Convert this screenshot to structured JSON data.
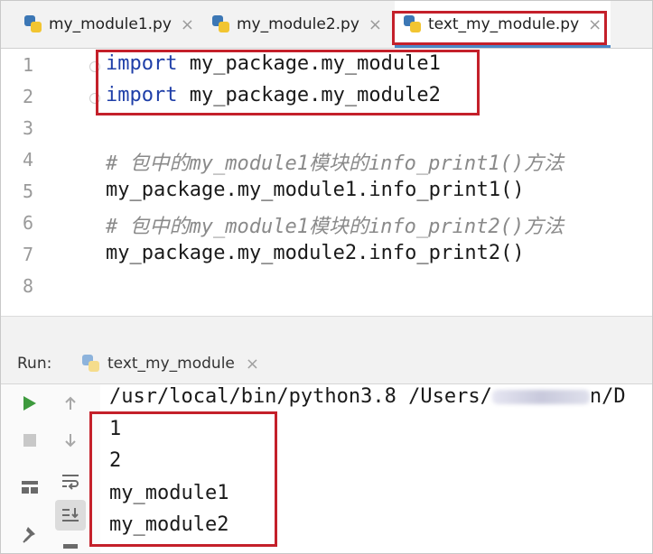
{
  "tabs": [
    {
      "label": "my_module1.py",
      "close": "×"
    },
    {
      "label": "my_module2.py",
      "close": "×"
    },
    {
      "label": "text_my_module.py",
      "close": "×"
    }
  ],
  "editor": {
    "line_numbers": [
      "1",
      "2",
      "3",
      "4",
      "5",
      "6",
      "7",
      "8"
    ],
    "lines": {
      "l1_kw": "import",
      "l1_rest": " my_package.my_module1",
      "l2_kw": "import",
      "l2_rest": " my_package.my_module2",
      "l4": "# 包中的my_module1模块的info_print1()方法",
      "l5": "my_package.my_module1.info_print1()",
      "l6": "# 包中的my_module1模块的info_print2()方法",
      "l7": "my_package.my_module2.info_print2()"
    }
  },
  "run": {
    "label": "Run:",
    "tab_label": "text_my_module",
    "tab_close": "×",
    "console": {
      "path_start": "/usr/local/bin/python3.8 /Users/",
      "path_end": "n/D",
      "outputs": [
        "1",
        "2",
        "my_module1",
        "my_module2"
      ]
    }
  },
  "colors": {
    "highlight_box": "#c4202a",
    "keyword": "#1f3fa8",
    "comment": "#8a8a8a",
    "run_green": "#3d9a3d"
  }
}
